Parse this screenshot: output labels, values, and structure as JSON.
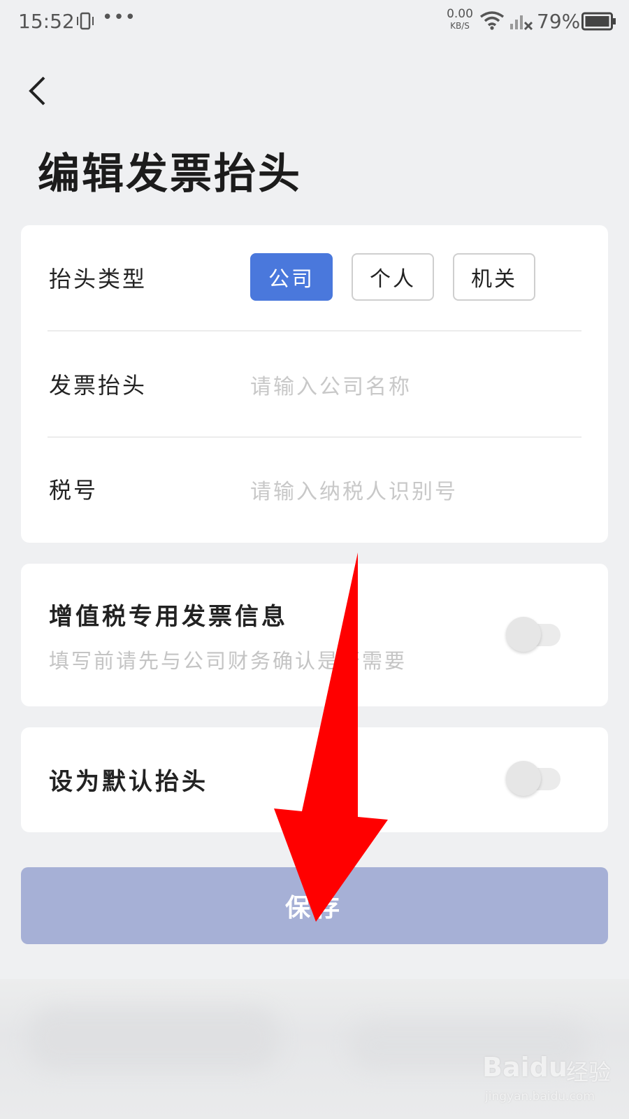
{
  "status_bar": {
    "time": "15:52",
    "more": "•••",
    "net_speed_value": "0.00",
    "net_speed_unit": "KB/S",
    "battery_percent": "79%"
  },
  "header": {
    "title": "编辑发票抬头"
  },
  "form": {
    "header_type_label": "抬头类型",
    "type_options": [
      "公司",
      "个人",
      "机关"
    ],
    "selected_type": "公司",
    "invoice_title_label": "发票抬头",
    "invoice_title_placeholder": "请输入公司名称",
    "invoice_title_value": "",
    "tax_id_label": "税号",
    "tax_id_placeholder": "请输入纳税人识别号",
    "tax_id_value": ""
  },
  "vat": {
    "title": "增值税专用发票信息",
    "subtitle": "填写前请先与公司财务确认是否需要",
    "enabled": false
  },
  "default_header": {
    "title": "设为默认抬头",
    "enabled": false
  },
  "save_button": {
    "label": "保存"
  },
  "watermark": {
    "logo": "Baidu",
    "brand_cn": "经验",
    "url": "jingyan.baidu.com"
  },
  "colors": {
    "accent": "#4a78dc",
    "save_button": "#a6b0d6",
    "annotation_arrow": "#ff0000"
  }
}
